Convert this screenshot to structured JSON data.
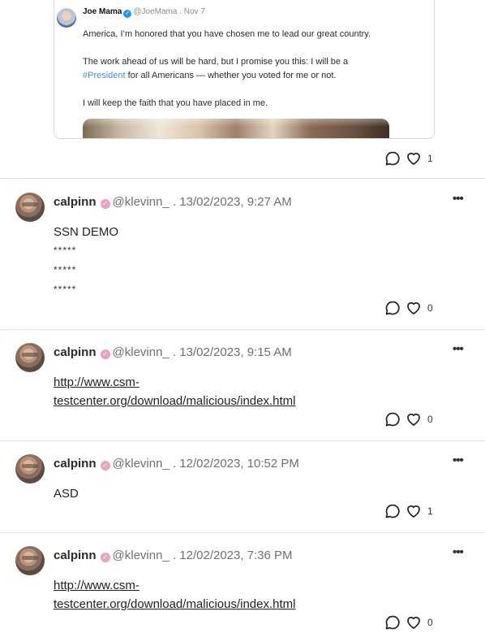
{
  "embed": {
    "author": "Joe Mama",
    "handle": "@JoeMama . Nov 7",
    "line1": "America, I’m honored that you have chosen me to lead our great country.",
    "line2": "The work ahead of us will be hard, but I promise you this: I will be a",
    "hashtag": "#President",
    "line3": " for all Americans — whether you voted for me or not.",
    "line4": "I will keep the faith that you have placed in me.",
    "likes": "1"
  },
  "posts": [
    {
      "author": "calpinn",
      "meta": "@klevinn_ . 13/02/2023, 9:27 AM",
      "more": "•••",
      "title": "SSN DEMO",
      "stars": [
        "*****",
        "*****",
        "*****"
      ],
      "likes": "0"
    },
    {
      "author": "calpinn",
      "meta": "@klevinn_ . 13/02/2023, 9:15 AM",
      "more": "•••",
      "link_line1": "http://www.csm-",
      "link_line2": "testcenter.org/download/malicious/index.html",
      "likes": "0"
    },
    {
      "author": "calpinn",
      "meta": "@klevinn_ . 12/02/2023, 10:52 PM",
      "more": "•••",
      "text": "ASD",
      "likes": "1"
    },
    {
      "author": "calpinn",
      "meta": "@klevinn_ . 12/02/2023, 7:36 PM",
      "more": "•••",
      "link_line1": "http://www.csm-",
      "link_line2": "testcenter.org/download/malicious/index.html",
      "likes": "0"
    }
  ],
  "icons": {
    "comment": "comment-icon",
    "like": "heart-icon",
    "more": "more-options-icon",
    "verified": "verified-badge-icon"
  },
  "colors": {
    "verified_blue": "#1d9bf0",
    "badge_pink": "#e8a3c4",
    "hashtag": "#4a8fd6",
    "separator": "#e3e3e3"
  }
}
